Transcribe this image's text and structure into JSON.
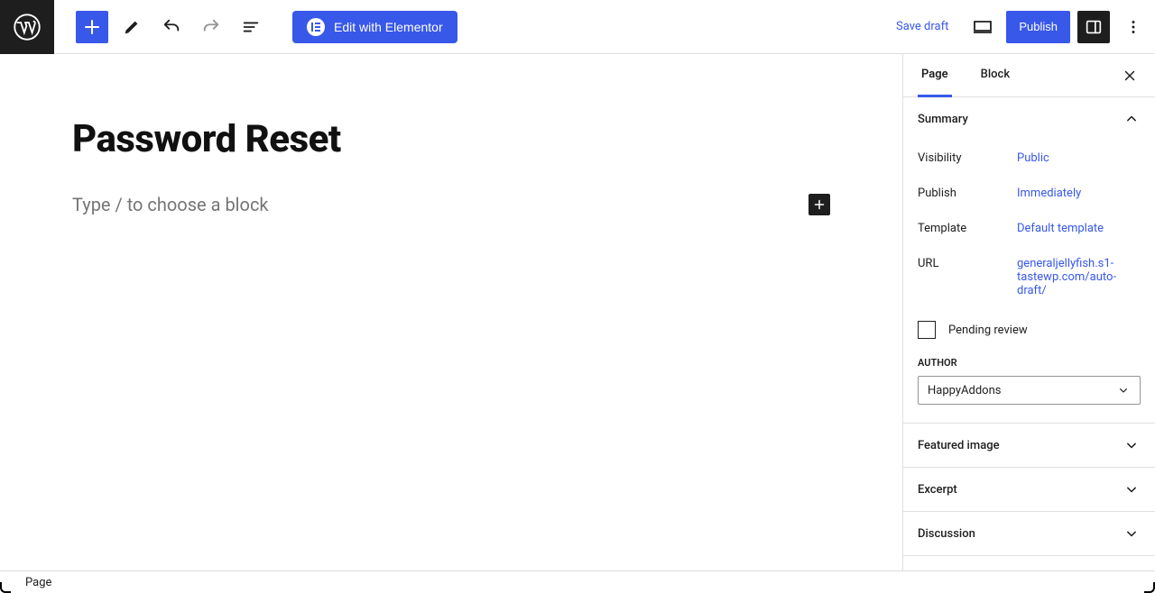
{
  "toolbar": {
    "save_draft": "Save draft",
    "publish": "Publish",
    "elementor": "Edit with Elementor"
  },
  "editor": {
    "title": "Password Reset",
    "placeholder": "Type / to choose a block"
  },
  "sidebar": {
    "tabs": {
      "page": "Page",
      "block": "Block"
    },
    "summary": {
      "heading": "Summary",
      "visibility_label": "Visibility",
      "visibility_value": "Public",
      "publish_label": "Publish",
      "publish_value": "Immediately",
      "template_label": "Template",
      "template_value": "Default template",
      "url_label": "URL",
      "url_value": "generaljellyfish.s1-tastewp.com/auto-draft/",
      "pending_label": "Pending review",
      "author_heading": "AUTHOR",
      "author_value": "HappyAddons"
    },
    "panels": {
      "featured_image": "Featured image",
      "excerpt": "Excerpt",
      "discussion": "Discussion"
    }
  },
  "footer": {
    "breadcrumb": "Page"
  }
}
